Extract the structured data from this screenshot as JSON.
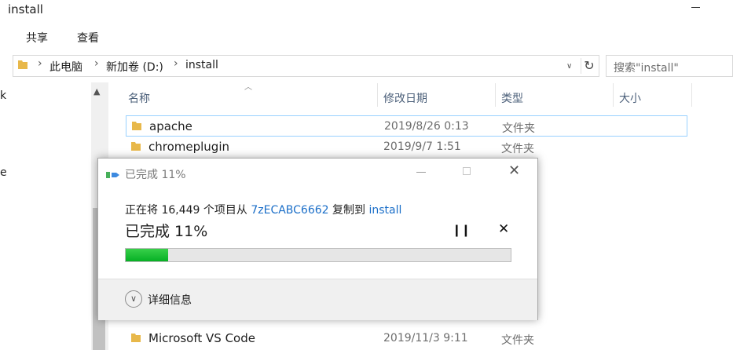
{
  "window": {
    "title": "install"
  },
  "ribbon": {
    "tabs": [
      "共享",
      "查看"
    ]
  },
  "address": {
    "crumbs": [
      "此电脑",
      "新加卷 (D:)",
      "install"
    ],
    "search_placeholder": "搜索\"install\""
  },
  "nav": {
    "fragments": [
      "k",
      "e"
    ]
  },
  "columns": {
    "name": "名称",
    "date": "修改日期",
    "type": "类型",
    "size": "大小"
  },
  "rows": [
    {
      "name": "apache",
      "date": "2019/8/26 0:13",
      "type": "文件夹"
    },
    {
      "name": "chromeplugin",
      "date": "2019/9/7 1:51",
      "type": "文件夹"
    },
    {
      "name": "Microsoft VS Code",
      "date": "2019/11/3 9:11",
      "type": "文件夹"
    }
  ],
  "dialog": {
    "title": "已完成 11%",
    "line_prefix": "正在将 16,449 个项目从 ",
    "source": "7zECABC6662",
    "line_mid": " 复制到 ",
    "dest": "install",
    "big_status": "已完成 11%",
    "progress_percent": 11,
    "progress_color": "#06b025",
    "details_label": "详细信息"
  },
  "colors": {
    "folder": "#e8b84a",
    "link": "#1a6ec8",
    "selection_border": "#99d1ff"
  }
}
